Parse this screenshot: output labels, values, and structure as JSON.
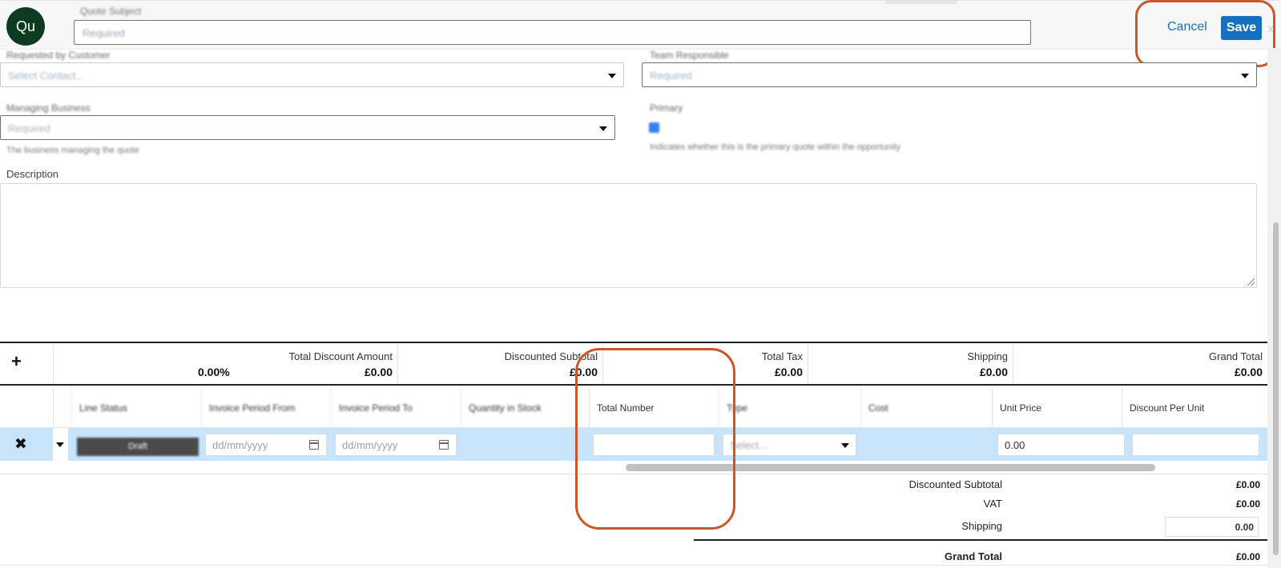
{
  "header": {
    "avatar_initials": "Qu",
    "quote_subject_label": "Quote Subject",
    "quote_subject_placeholder": "Required",
    "cancel_label": "Cancel",
    "save_label": "Save",
    "close_glyph": "x"
  },
  "form": {
    "requested_by_label": "Requested by Customer",
    "requested_by_placeholder": "Select Contact...",
    "team_label": "Team Responsible",
    "team_placeholder": "Required",
    "managing_business_label": "Managing Business",
    "managing_business_placeholder": "Required",
    "managing_business_help": "The business managing the quote",
    "primary_label": "Primary",
    "primary_help": "Indicates whether this is the primary quote within the opportunity",
    "description_label": "Description"
  },
  "totals": {
    "add_glyph": "+",
    "total_discount_label": "Total Discount Amount",
    "total_discount_percent": "0.00%",
    "total_discount_value": "£0.00",
    "discounted_subtotal_label": "Discounted Subtotal",
    "discounted_subtotal_value": "£0.00",
    "total_tax_label": "Total Tax",
    "total_tax_value": "£0.00",
    "shipping_label": "Shipping",
    "shipping_value": "£0.00",
    "grand_total_label": "Grand Total",
    "grand_total_value": "£0.00"
  },
  "columns": {
    "line_status": "Line Status",
    "invoice_from": "Invoice Period From",
    "invoice_to": "Invoice Period To",
    "quantity_in_stock": "Quantity in Stock",
    "total_number": "Total Number",
    "type": "Type",
    "cost": "Cost",
    "unit_price": "Unit Price",
    "discount_per_unit": "Discount Per Unit"
  },
  "line": {
    "delete_glyph": "✖",
    "status": "Draft",
    "date_placeholder_from": "dd/mm/yyyy",
    "date_placeholder_to": "dd/mm/yyyy",
    "type_placeholder": "Select...",
    "unit_price": "0.00"
  },
  "summary": {
    "discounted_subtotal_label": "Discounted Subtotal",
    "discounted_subtotal_value": "£0.00",
    "vat_label": "VAT",
    "vat_value": "£0.00",
    "shipping_label": "Shipping",
    "shipping_value": "0.00",
    "grand_total_label": "Grand Total",
    "grand_total_value": "£0.00"
  },
  "colors": {
    "accent": "#1670c2",
    "avatar_bg": "#0c3b22",
    "highlight_row": "#c8e4fa",
    "annotation": "#c8582a"
  }
}
